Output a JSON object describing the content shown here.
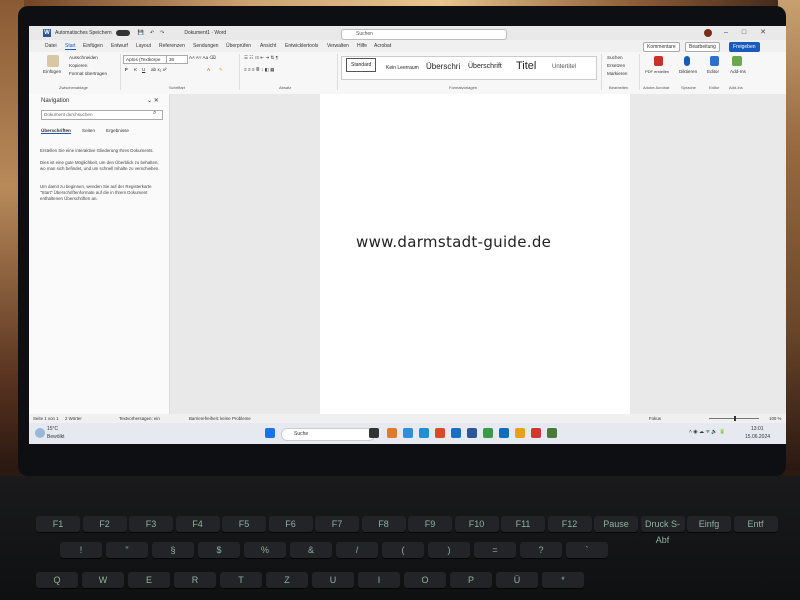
{
  "titlebar": {
    "autosave": "Automatisches Speichern",
    "doc_title": "Dokument1  ·  Word",
    "search_placeholder": "Suchen"
  },
  "tabs": [
    "Datei",
    "Start",
    "Einfügen",
    "Entwurf",
    "Layout",
    "Referenzen",
    "Sendungen",
    "Überprüfen",
    "Ansicht",
    "Entwicklertools",
    "Verwalten",
    "Hilfe",
    "Acrobat"
  ],
  "tab_buttons": {
    "comments": "Kommentare",
    "edit": "Bearbeitung",
    "share": "Freigeben"
  },
  "ribbon": {
    "clipboard": {
      "paste": "Einfügen",
      "cut": "Ausschneiden",
      "copy": "Kopieren",
      "format": "Format übertragen",
      "label": "Zwischenablage"
    },
    "font": {
      "name": "Aptos (Textkörpe",
      "size": "36",
      "label": "Schriftart"
    },
    "paragraph_label": "Absatz",
    "styles": [
      "Standard",
      "Kein Leerraum",
      "Überschri",
      "Überschrift",
      "Titel",
      "Untertitel"
    ],
    "styles_label": "Formatvorlagen",
    "editing": {
      "search": "Suchen",
      "replace": "Ersetzen",
      "select": "Markieren",
      "label": "Bearbeiten"
    },
    "acrobat": {
      "pdf": "PDF erstellen",
      "label": "Adobe Acrobat"
    },
    "voice": {
      "dictate": "Diktieren",
      "label": "Sprache"
    },
    "editor": {
      "editor": "Editor",
      "label": "Editor"
    },
    "addins": {
      "addins": "Add-Ins",
      "label": "Add-Ins"
    }
  },
  "nav": {
    "title": "Navigation",
    "search_placeholder": "Dokument durchsuchen",
    "tabs": [
      "Überschriften",
      "Seiten",
      "Ergebnisse"
    ],
    "p1": "Erstellen Sie eine interaktive Gliederung Ihres Dokuments.",
    "p2": "Dies ist eine gute Möglichkeit, um den Überblick zu behalten, wo man sich befindet, und um schnell Inhalte zu verschieben.",
    "p3": "Um damit zu beginnen, wenden Sie auf der Registerkarte \"Start\" Überschriftenformate auf die in Ihrem Dokument enthaltenen Überschriften an."
  },
  "document": {
    "text": "www.darmstadt-guide.de"
  },
  "status": {
    "page": "Seite 1 von 1",
    "words": "2 Wörter",
    "text_predictions": "Textvorhersagen: ein",
    "accessibility": "Barrierefreiheit: keine Probleme",
    "focus": "Fokus",
    "zoom": "100 %"
  },
  "taskbar": {
    "weather_temp": "15°C",
    "weather_desc": "Bewölkt",
    "search": "Suche",
    "time": "13:01",
    "date": "15.06.2024"
  },
  "keyboard": {
    "fkeys": [
      "F1",
      "F2",
      "F3",
      "F4",
      "F5",
      "F6",
      "F7",
      "F8",
      "F9",
      "F10",
      "F11",
      "F12",
      "Pause",
      "Druck S-Abf",
      "Einfg",
      "Entf"
    ],
    "numrow": [
      "!",
      "\"",
      "§",
      "$",
      "%",
      "&",
      "/",
      "(",
      ")",
      "=",
      "?",
      "`"
    ],
    "letters": [
      "Q",
      "W",
      "E",
      "R",
      "T",
      "Z",
      "U",
      "I",
      "O",
      "P",
      "Ü",
      "*"
    ]
  }
}
